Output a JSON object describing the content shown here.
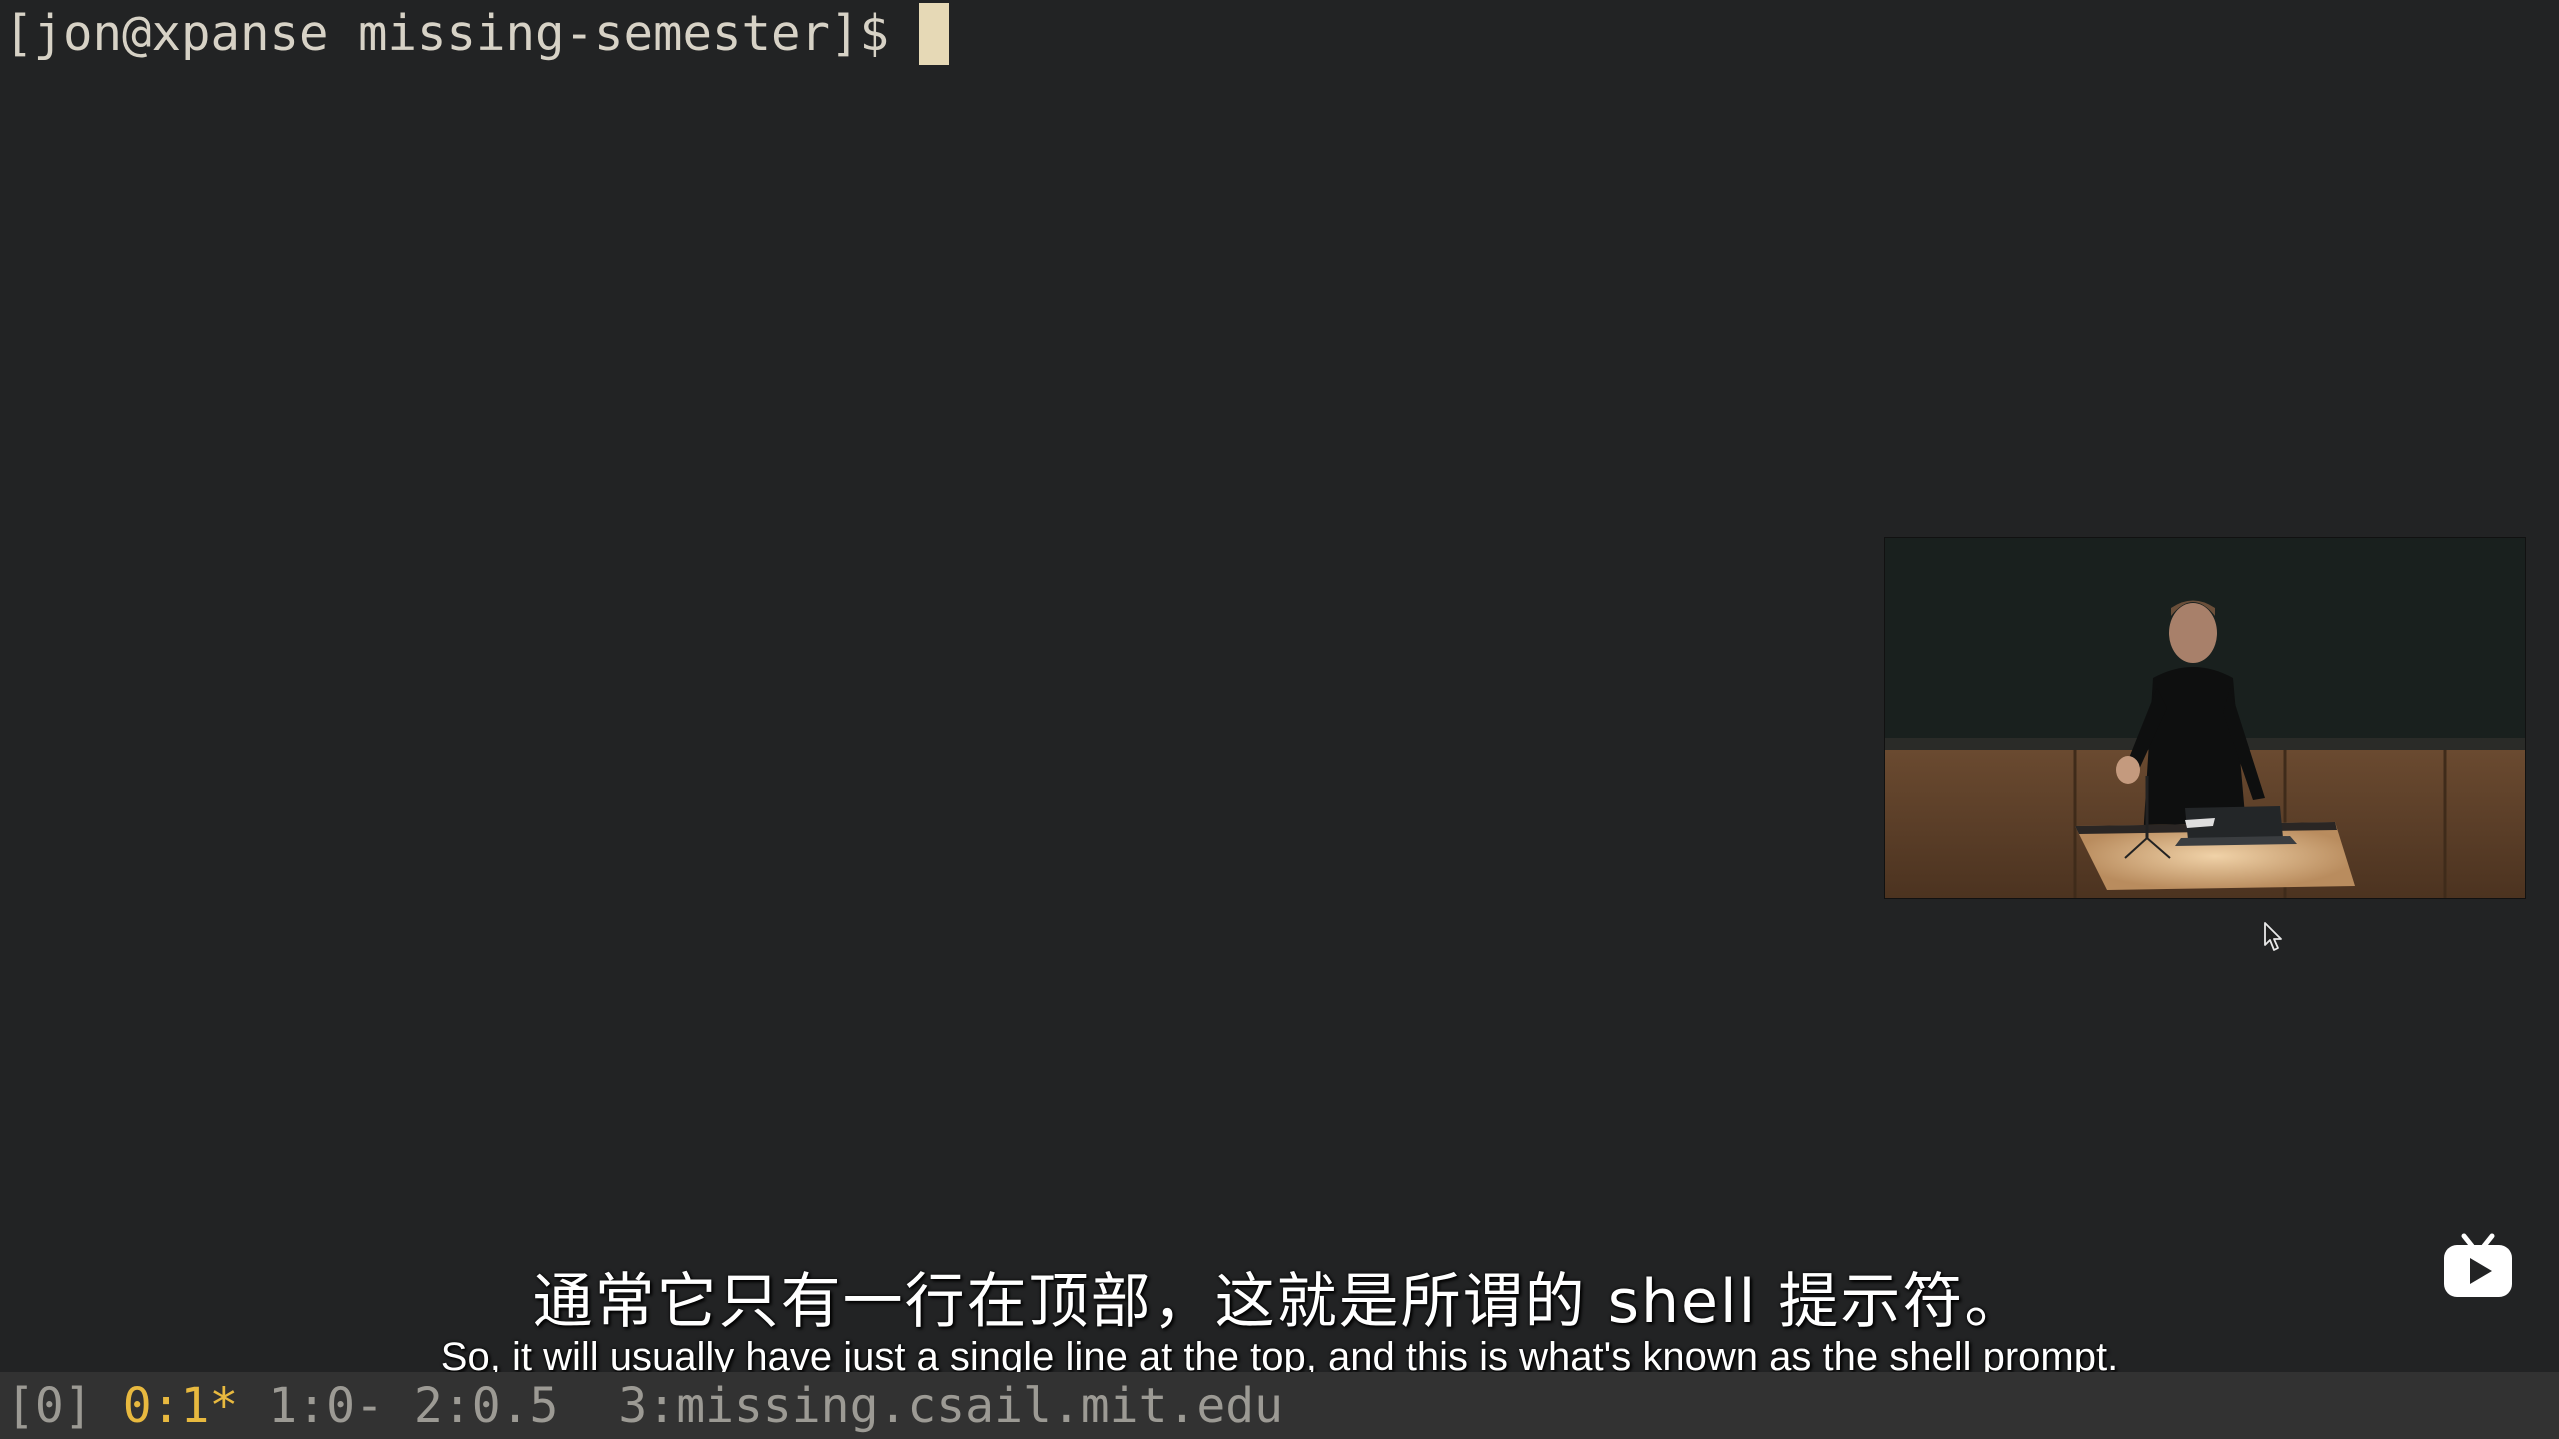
{
  "terminal": {
    "prompt": "[jon@xpanse missing-semester]$"
  },
  "subtitles": {
    "zh": "通常它只有一行在顶部，这就是所谓的 shell 提示符。",
    "en": "So, it will usually have just a single line at the top, and this is what's known as the shell prompt."
  },
  "tmux_status": {
    "session": "[0]",
    "windows": [
      {
        "label": "0:1*",
        "active": true
      },
      {
        "label": "1:0-",
        "active": false
      },
      {
        "label": "2:0.5",
        "active": false
      },
      {
        "label": "3:missing.csail.mit.edu",
        "active": false
      }
    ]
  },
  "icons": {
    "pip_video": "lecturer-video-thumbnail",
    "pointer": "mouse-pointer-icon",
    "logo": "bilibili-tv-icon"
  },
  "colors": {
    "background": "#222324",
    "prompt_text": "#d7d2c6",
    "cursor": "#e6d9b6",
    "status_bar": "#323232",
    "active_window": "#e8b93f",
    "inactive_window": "#9c9a94"
  }
}
